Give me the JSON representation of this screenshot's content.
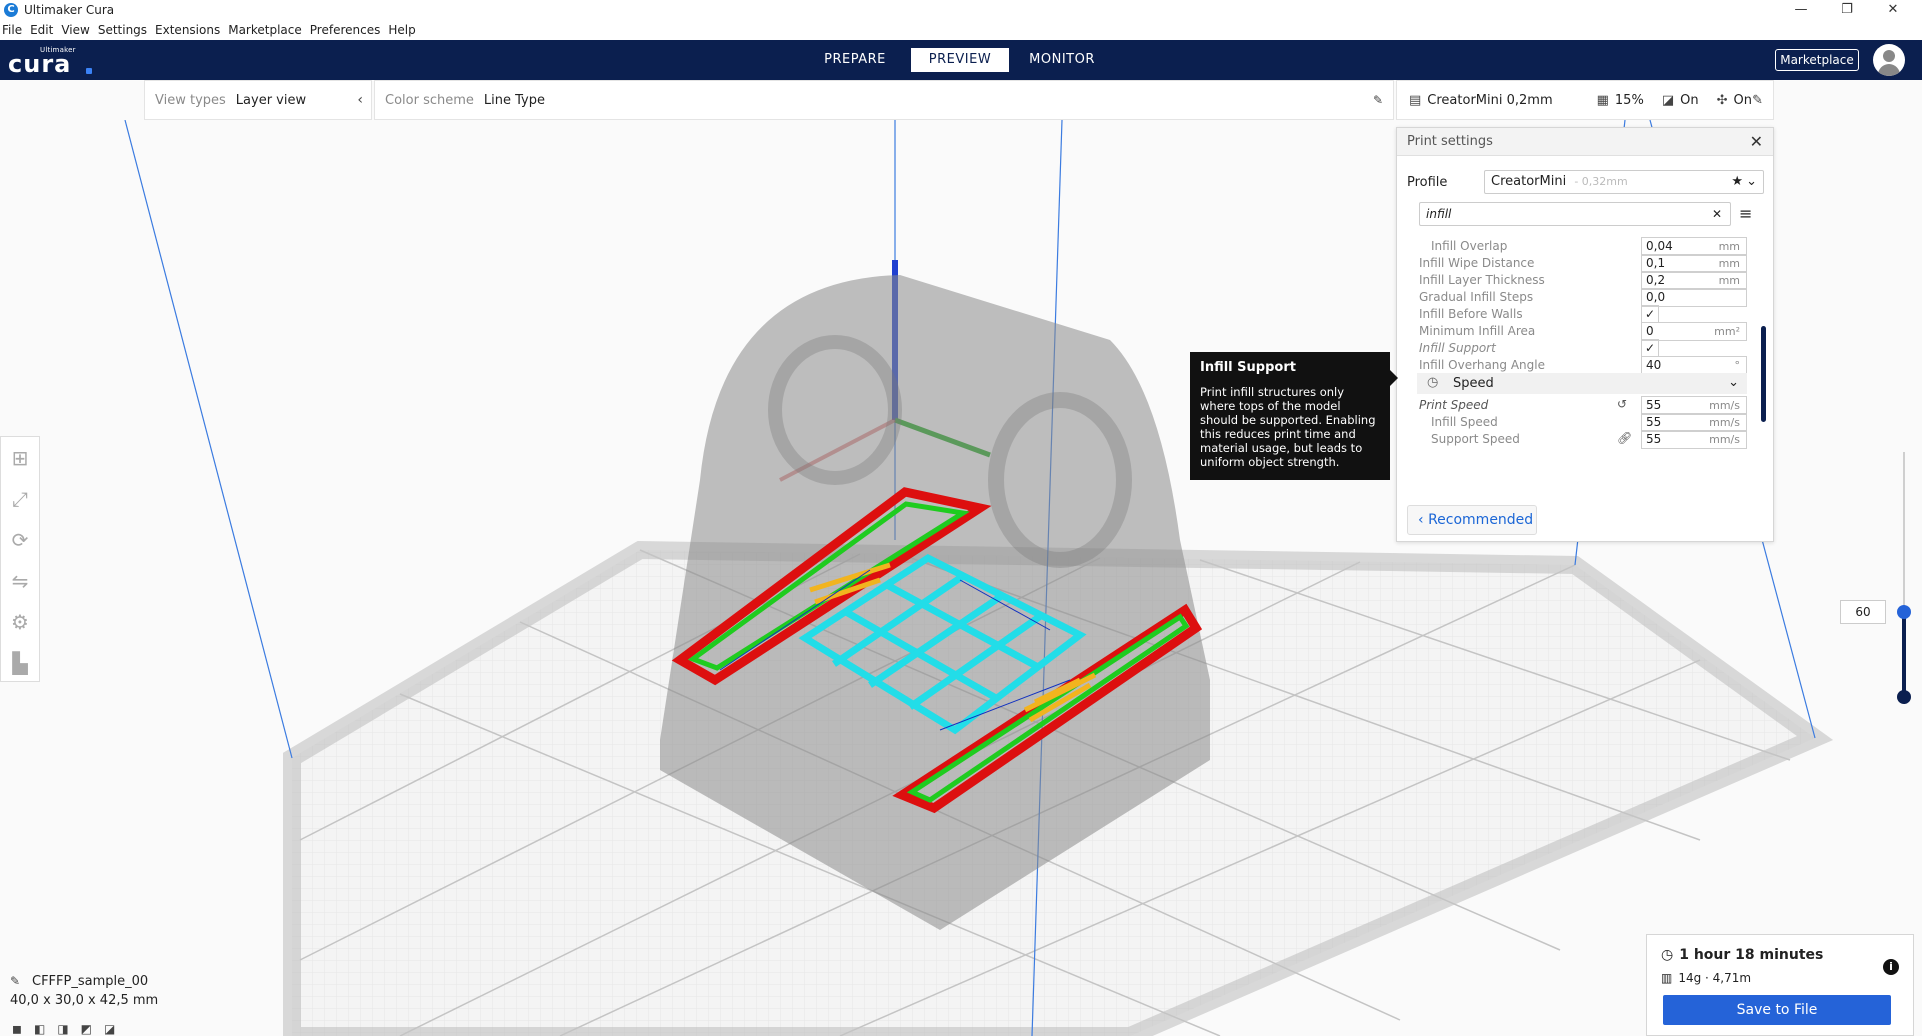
{
  "window": {
    "title": "Ultimaker Cura",
    "controls": [
      "—",
      "❐",
      "✕"
    ]
  },
  "menu": [
    "File",
    "Edit",
    "View",
    "Settings",
    "Extensions",
    "Marketplace",
    "Preferences",
    "Help"
  ],
  "header": {
    "logo_sub": "Ultimaker",
    "logo_main": "cura",
    "stages": [
      "PREPARE",
      "PREVIEW",
      "MONITOR"
    ],
    "active_stage": "PREVIEW",
    "marketplace_button": "Marketplace"
  },
  "view_panel": {
    "view_types_label": "View types",
    "view_types_value": "Layer view",
    "color_scheme_label": "Color scheme",
    "color_scheme_value": "Line Type"
  },
  "print_setup": {
    "printer_profile": "CreatorMini 0,2mm",
    "infill": "15%",
    "support": "On",
    "adhesion": "On"
  },
  "settings_panel": {
    "title": "Print settings",
    "profile_label": "Profile",
    "profile_value": "CreatorMini",
    "profile_suffix": "- 0,32mm",
    "search_value": "infill",
    "rows": [
      {
        "name": "Infill Overlap",
        "value": "0,04",
        "unit": "mm",
        "indent": 2
      },
      {
        "name": "Infill Wipe Distance",
        "value": "0,1",
        "unit": "mm",
        "indent": 1
      },
      {
        "name": "Infill Layer Thickness",
        "value": "0,2",
        "unit": "mm",
        "indent": 1
      },
      {
        "name": "Gradual Infill Steps",
        "value": "0,0",
        "unit": "",
        "indent": 1
      },
      {
        "name": "Infill Before Walls",
        "value": "✓",
        "unit": "",
        "indent": 1,
        "checkbox": true
      },
      {
        "name": "Minimum Infill Area",
        "value": "0",
        "unit": "mm²",
        "indent": 1
      },
      {
        "name": "Infill Support",
        "value": "✓",
        "unit": "",
        "indent": 1,
        "checkbox": true,
        "italic": true
      },
      {
        "name": "Infill Overhang Angle",
        "value": "40",
        "unit": "°",
        "indent": 1
      }
    ],
    "category": "Speed",
    "speed_rows": [
      {
        "name": "Print Speed",
        "value": "55",
        "unit": "mm/s",
        "indent": 1,
        "italic": true
      },
      {
        "name": "Infill Speed",
        "value": "55",
        "unit": "mm/s",
        "indent": 2
      },
      {
        "name": "Support Speed",
        "value": "55",
        "unit": "mm/s",
        "indent": 2
      }
    ],
    "recommended_button": "Recommended"
  },
  "tooltip": {
    "title": "Infill Support",
    "body": "Print infill structures only where tops of the model should be supported. Enabling this reduces print time and material usage, but leads to uniform object strength."
  },
  "layer_slider": {
    "current_layer": "60"
  },
  "object": {
    "name": "CFFFP_sample_00",
    "dimensions": "40,0 x 30,0 x 42,5 mm"
  },
  "print_output": {
    "time": "1 hour 18 minutes",
    "material": "14g · 4,71m",
    "save_button": "Save to File"
  },
  "colors": {
    "header_bg": "#0b1f4f",
    "accent_blue": "#2563d8",
    "wall_red": "#e01010",
    "wall_green": "#22cc22",
    "infill_cyan": "#22dde8",
    "support_yellow": "#f2b41e"
  }
}
